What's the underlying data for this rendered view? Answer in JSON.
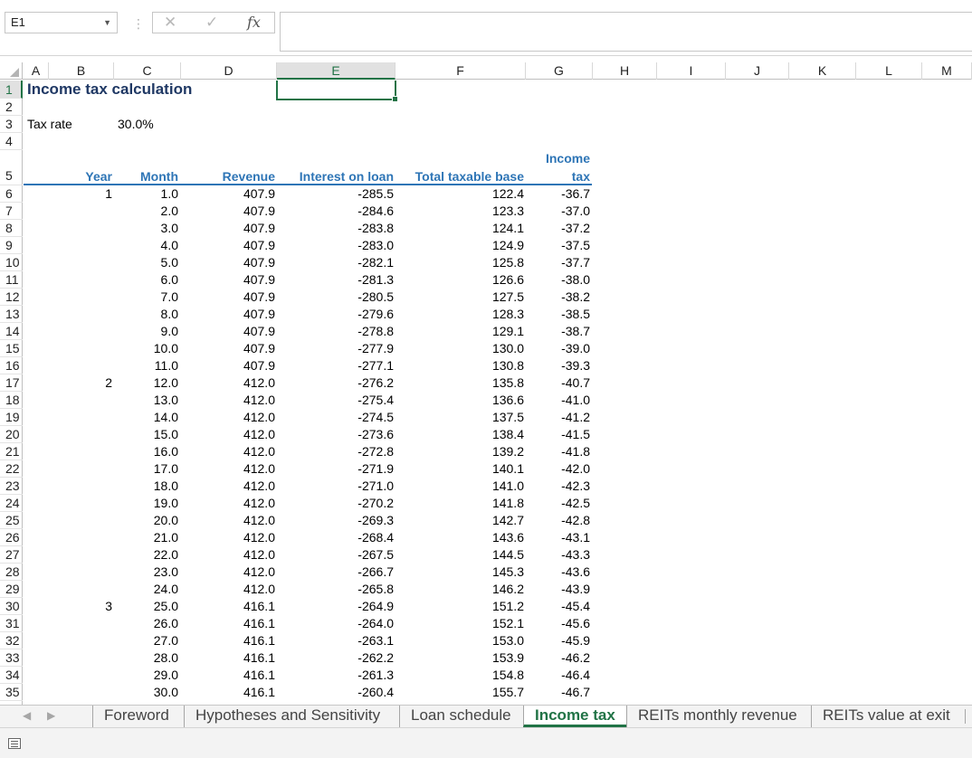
{
  "formula_bar": {
    "name_box": "E1",
    "cancel_icon": "✕",
    "enter_icon": "✓",
    "fx_label": "fx",
    "formula": ""
  },
  "columns": [
    "A",
    "B",
    "C",
    "D",
    "E",
    "F",
    "G",
    "H",
    "I",
    "J",
    "K",
    "L",
    "M"
  ],
  "selected_column": "E",
  "selected_row": 1,
  "rows": [
    "1",
    "2",
    "3",
    "4",
    "5",
    "6",
    "7",
    "8",
    "9",
    "10",
    "11",
    "12",
    "13",
    "14",
    "15",
    "16",
    "17",
    "18",
    "19",
    "20",
    "21",
    "22",
    "23",
    "24",
    "25",
    "26",
    "27",
    "28",
    "29",
    "30",
    "31",
    "32",
    "33",
    "34",
    "35"
  ],
  "sheet": {
    "title": "Income tax calculation",
    "tax_rate_label": "Tax rate",
    "tax_rate_value": "30.0%",
    "headers": {
      "year": "Year",
      "month": "Month",
      "revenue": "Revenue",
      "interest": "Interest on loan",
      "taxable_base": "Total taxable base",
      "income_tax_line1": "Income",
      "income_tax_line2": "tax"
    },
    "data": [
      {
        "year": "1",
        "month": "1.0",
        "revenue": "407.9",
        "interest": "-285.5",
        "base": "122.4",
        "tax": "-36.7"
      },
      {
        "year": "",
        "month": "2.0",
        "revenue": "407.9",
        "interest": "-284.6",
        "base": "123.3",
        "tax": "-37.0"
      },
      {
        "year": "",
        "month": "3.0",
        "revenue": "407.9",
        "interest": "-283.8",
        "base": "124.1",
        "tax": "-37.2"
      },
      {
        "year": "",
        "month": "4.0",
        "revenue": "407.9",
        "interest": "-283.0",
        "base": "124.9",
        "tax": "-37.5"
      },
      {
        "year": "",
        "month": "5.0",
        "revenue": "407.9",
        "interest": "-282.1",
        "base": "125.8",
        "tax": "-37.7"
      },
      {
        "year": "",
        "month": "6.0",
        "revenue": "407.9",
        "interest": "-281.3",
        "base": "126.6",
        "tax": "-38.0"
      },
      {
        "year": "",
        "month": "7.0",
        "revenue": "407.9",
        "interest": "-280.5",
        "base": "127.5",
        "tax": "-38.2"
      },
      {
        "year": "",
        "month": "8.0",
        "revenue": "407.9",
        "interest": "-279.6",
        "base": "128.3",
        "tax": "-38.5"
      },
      {
        "year": "",
        "month": "9.0",
        "revenue": "407.9",
        "interest": "-278.8",
        "base": "129.1",
        "tax": "-38.7"
      },
      {
        "year": "",
        "month": "10.0",
        "revenue": "407.9",
        "interest": "-277.9",
        "base": "130.0",
        "tax": "-39.0"
      },
      {
        "year": "",
        "month": "11.0",
        "revenue": "407.9",
        "interest": "-277.1",
        "base": "130.8",
        "tax": "-39.3"
      },
      {
        "year": "2",
        "month": "12.0",
        "revenue": "412.0",
        "interest": "-276.2",
        "base": "135.8",
        "tax": "-40.7"
      },
      {
        "year": "",
        "month": "13.0",
        "revenue": "412.0",
        "interest": "-275.4",
        "base": "136.6",
        "tax": "-41.0"
      },
      {
        "year": "",
        "month": "14.0",
        "revenue": "412.0",
        "interest": "-274.5",
        "base": "137.5",
        "tax": "-41.2"
      },
      {
        "year": "",
        "month": "15.0",
        "revenue": "412.0",
        "interest": "-273.6",
        "base": "138.4",
        "tax": "-41.5"
      },
      {
        "year": "",
        "month": "16.0",
        "revenue": "412.0",
        "interest": "-272.8",
        "base": "139.2",
        "tax": "-41.8"
      },
      {
        "year": "",
        "month": "17.0",
        "revenue": "412.0",
        "interest": "-271.9",
        "base": "140.1",
        "tax": "-42.0"
      },
      {
        "year": "",
        "month": "18.0",
        "revenue": "412.0",
        "interest": "-271.0",
        "base": "141.0",
        "tax": "-42.3"
      },
      {
        "year": "",
        "month": "19.0",
        "revenue": "412.0",
        "interest": "-270.2",
        "base": "141.8",
        "tax": "-42.5"
      },
      {
        "year": "",
        "month": "20.0",
        "revenue": "412.0",
        "interest": "-269.3",
        "base": "142.7",
        "tax": "-42.8"
      },
      {
        "year": "",
        "month": "21.0",
        "revenue": "412.0",
        "interest": "-268.4",
        "base": "143.6",
        "tax": "-43.1"
      },
      {
        "year": "",
        "month": "22.0",
        "revenue": "412.0",
        "interest": "-267.5",
        "base": "144.5",
        "tax": "-43.3"
      },
      {
        "year": "",
        "month": "23.0",
        "revenue": "412.0",
        "interest": "-266.7",
        "base": "145.3",
        "tax": "-43.6"
      },
      {
        "year": "",
        "month": "24.0",
        "revenue": "412.0",
        "interest": "-265.8",
        "base": "146.2",
        "tax": "-43.9"
      },
      {
        "year": "3",
        "month": "25.0",
        "revenue": "416.1",
        "interest": "-264.9",
        "base": "151.2",
        "tax": "-45.4"
      },
      {
        "year": "",
        "month": "26.0",
        "revenue": "416.1",
        "interest": "-264.0",
        "base": "152.1",
        "tax": "-45.6"
      },
      {
        "year": "",
        "month": "27.0",
        "revenue": "416.1",
        "interest": "-263.1",
        "base": "153.0",
        "tax": "-45.9"
      },
      {
        "year": "",
        "month": "28.0",
        "revenue": "416.1",
        "interest": "-262.2",
        "base": "153.9",
        "tax": "-46.2"
      },
      {
        "year": "",
        "month": "29.0",
        "revenue": "416.1",
        "interest": "-261.3",
        "base": "154.8",
        "tax": "-46.4"
      },
      {
        "year": "",
        "month": "30.0",
        "revenue": "416.1",
        "interest": "-260.4",
        "base": "155.7",
        "tax": "-46.7"
      }
    ]
  },
  "tabs": [
    {
      "label": "Foreword",
      "active": false
    },
    {
      "label": "Hypotheses and Sensitivity",
      "active": false
    },
    {
      "label": "Loan schedule",
      "active": false
    },
    {
      "label": "Income tax",
      "active": true
    },
    {
      "label": "REITs monthly revenue",
      "active": false
    },
    {
      "label": "REITs value at exit",
      "active": false
    }
  ],
  "colors": {
    "accent_green": "#217346",
    "header_blue": "#2e75b6",
    "title_navy": "#1f3864"
  }
}
